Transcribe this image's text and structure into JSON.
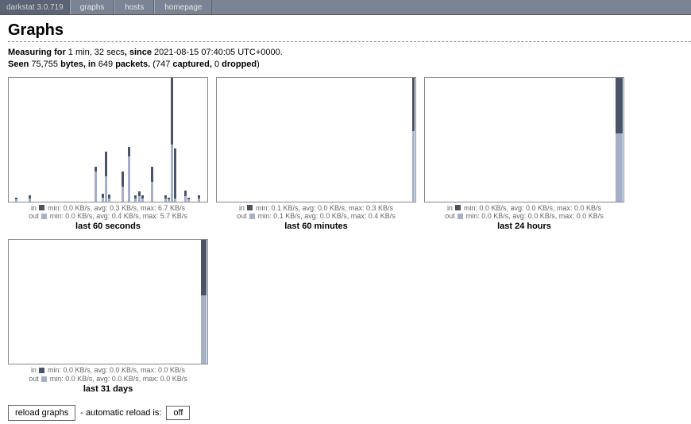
{
  "nav": {
    "brand": "darkstat 3.0.719",
    "items": [
      "graphs",
      "hosts",
      "homepage"
    ]
  },
  "page_title": "Graphs",
  "stats": {
    "measuring_for_label": "Measuring for",
    "duration": "1 min, 32 secs",
    "since_label": ", since",
    "since_time": "2021-08-15 07:40:05 UTC+0000",
    "seen_label": "Seen",
    "bytes": "75,755",
    "bytes_label": "bytes, in",
    "packets": "649",
    "packets_label": "packets.",
    "captured": "747",
    "captured_label": "captured,",
    "dropped": "0",
    "dropped_label": "dropped"
  },
  "graphs": [
    {
      "id": "sec",
      "title": "last 60 seconds",
      "legend_in": "min: 0.0 KB/s, avg: 0.3 KB/s, max: 6.7 KB/s",
      "legend_out": "min: 0.0 KB/s, avg: 0.4 KB/s, max: 5.7 KB/s"
    },
    {
      "id": "min",
      "title": "last 60 minutes",
      "legend_in": "min: 0.1 KB/s, avg: 0.0 KB/s, max: 0.3 KB/s",
      "legend_out": "min: 0.1 KB/s, avg: 0.0 KB/s, max: 0.4 KB/s"
    },
    {
      "id": "hr",
      "title": "last 24 hours",
      "legend_in": "min: 0.0 KB/s, avg: 0.0 KB/s, max: 0.0 KB/s",
      "legend_out": "min: 0.0 KB/s, avg: 0.0 KB/s, max: 0.0 KB/s"
    },
    {
      "id": "day",
      "title": "last 31 days",
      "legend_in": "min: 0.0 KB/s, avg: 0.0 KB/s, max: 0.0 KB/s",
      "legend_out": "min: 0.0 KB/s, avg: 0.0 KB/s, max: 0.0 KB/s"
    }
  ],
  "chart_data": [
    {
      "id": "sec",
      "type": "bar",
      "max_in": 6.7,
      "max_out": 5.7,
      "slots": 60,
      "bars": [
        {
          "slot": 2,
          "in": 0.2,
          "out": 0.2
        },
        {
          "slot": 6,
          "in": 0.3,
          "out": 0.3
        },
        {
          "slot": 26,
          "in": 0.5,
          "out": 3.0
        },
        {
          "slot": 28,
          "in": 0.4,
          "out": 0.4
        },
        {
          "slot": 29,
          "in": 2.5,
          "out": 2.5
        },
        {
          "slot": 30,
          "in": 0.4,
          "out": 0.3
        },
        {
          "slot": 34,
          "in": 1.5,
          "out": 1.5
        },
        {
          "slot": 36,
          "in": 1.0,
          "out": 4.5
        },
        {
          "slot": 38,
          "in": 0.3,
          "out": 0.3
        },
        {
          "slot": 39,
          "in": 0.5,
          "out": 0.5
        },
        {
          "slot": 40,
          "in": 0.3,
          "out": 0.3
        },
        {
          "slot": 43,
          "in": 1.5,
          "out": 2.0
        },
        {
          "slot": 47,
          "in": 0.3,
          "out": 0.3
        },
        {
          "slot": 48,
          "in": 0.2,
          "out": 0.2
        },
        {
          "slot": 49,
          "in": 6.7,
          "out": 5.7
        },
        {
          "slot": 50,
          "in": 5.0,
          "out": 0.3
        },
        {
          "slot": 53,
          "in": 0.6,
          "out": 0.5
        },
        {
          "slot": 54,
          "in": 0.2,
          "out": 0.2
        },
        {
          "slot": 57,
          "in": 0.3,
          "out": 0.3
        }
      ]
    },
    {
      "id": "min",
      "type": "bar",
      "max_in": 0.3,
      "max_out": 0.4,
      "slots": 60,
      "bars": [
        {
          "slot": 59,
          "in": 0.3,
          "out": 0.4
        }
      ]
    },
    {
      "id": "hr",
      "type": "bar",
      "max_in": 0.0,
      "max_out": 0.0,
      "slots": 24,
      "bars": [
        {
          "slot": 23,
          "in": 0.0,
          "out": 0.0,
          "full": true
        }
      ]
    },
    {
      "id": "day",
      "type": "bar",
      "max_in": 0.0,
      "max_out": 0.0,
      "slots": 31,
      "bars": [
        {
          "slot": 30,
          "in": 0.0,
          "out": 0.0,
          "full": true
        }
      ]
    }
  ],
  "controls": {
    "reload_label": "reload graphs",
    "auto_label": "- automatic reload is:",
    "auto_state": "off"
  },
  "legend_labels": {
    "in": "in",
    "out": "out"
  }
}
